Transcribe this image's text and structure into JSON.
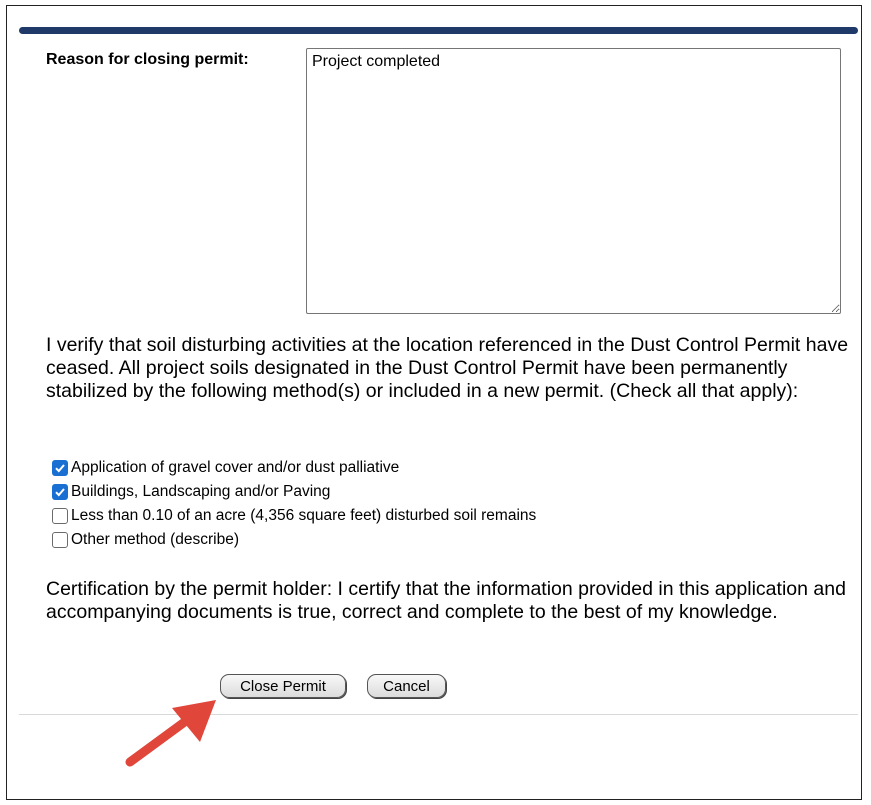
{
  "form": {
    "reason_label": "Reason for closing permit:",
    "reason_value": "Project completed",
    "verify_text": "I verify that soil disturbing activities at the location referenced in the Dust Control Permit have ceased. All project soils designated in the Dust Control Permit have been permanently stabilized by the following method(s) or included in a new permit. (Check all that apply):",
    "options": [
      {
        "label": "Application of gravel cover and/or dust palliative",
        "checked": true
      },
      {
        "label": "Buildings, Landscaping and/or Paving",
        "checked": true
      },
      {
        "label": "Less than 0.10 of an acre (4,356 square feet) disturbed soil remains",
        "checked": false
      },
      {
        "label": "Other method (describe)",
        "checked": false
      }
    ],
    "certification_text": "Certification by the permit holder: I certify that the information provided in this application and accompanying documents is true, correct and complete to the best of my knowledge.",
    "close_button": "Close Permit",
    "cancel_button": "Cancel"
  },
  "colors": {
    "header_bar": "#1f3a68",
    "checkbox_checked": "#1a6fd3",
    "annotation_arrow": "#e0463a"
  }
}
